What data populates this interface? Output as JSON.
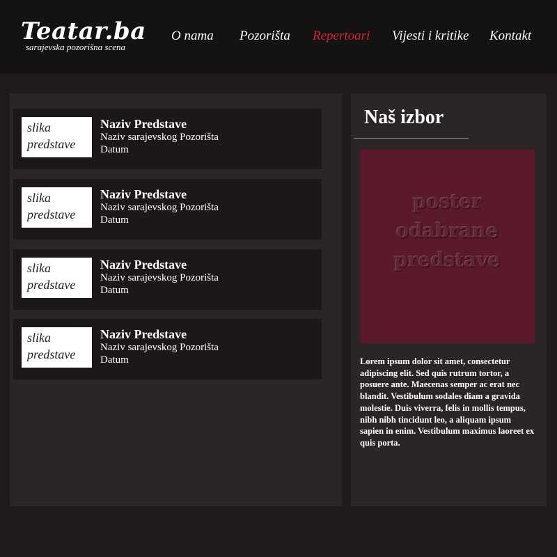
{
  "header": {
    "logo_title": "Teatar.ba",
    "logo_subtitle": "sarajevska pozorišna scena",
    "nav": [
      {
        "label": "O nama",
        "active": false
      },
      {
        "label": "Pozorišta",
        "active": false
      },
      {
        "label": "Repertoari",
        "active": true
      },
      {
        "label": "Vijesti i kritike",
        "active": false
      },
      {
        "label": "Kontakt",
        "active": false
      }
    ],
    "active_color": "#d42835"
  },
  "repertoire": {
    "items": [
      {
        "thumb_line1": "slika",
        "thumb_line2": "predstave",
        "title": "Naziv Predstave",
        "theatre": "Naziv sarajevskog Pozorišta",
        "date": "Datum"
      },
      {
        "thumb_line1": "slika",
        "thumb_line2": "predstave",
        "title": "Naziv Predstave",
        "theatre": "Naziv sarajevskog Pozorišta",
        "date": "Datum"
      },
      {
        "thumb_line1": "slika",
        "thumb_line2": "predstave",
        "title": "Naziv Predstave",
        "theatre": "Naziv sarajevskog Pozorišta",
        "date": "Datum"
      },
      {
        "thumb_line1": "slika",
        "thumb_line2": "predstave",
        "title": "Naziv Predstave",
        "theatre": "Naziv sarajevskog Pozorišta",
        "date": "Datum"
      }
    ]
  },
  "sidebar": {
    "heading": "Naš izbor",
    "poster_line1": "poster",
    "poster_line2": "odabrane",
    "poster_line3": "predstave",
    "poster_color": "#5b1a2c",
    "description": "Lorem ipsum dolor sit amet, consectetur adipiscing elit. Sed quis rutrum tortor, a posuere ante. Maecenas semper ac erat nec blandit. Vestibulum sodales diam a gravida molestie. Duis viverra, felis in mollis tempus, nibh nibh tincidunt leo, a aliquam ipsum sapien in enim. Vestibulum maximus laoreet ex quis porta."
  }
}
